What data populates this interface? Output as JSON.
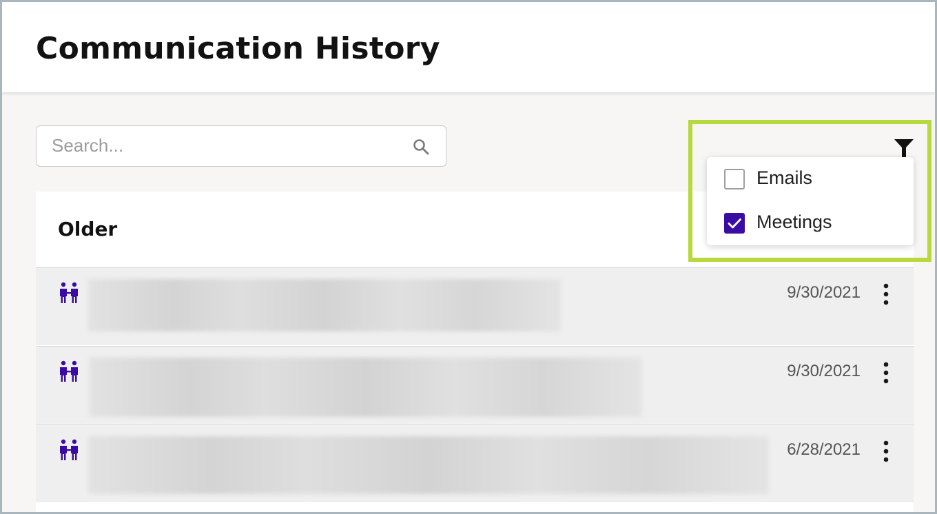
{
  "header": {
    "title": "Communication History"
  },
  "search": {
    "placeholder": "Search...",
    "value": "",
    "icon": "search-icon"
  },
  "filter": {
    "icon": "filter-icon",
    "options": [
      {
        "label": "Emails",
        "checked": false
      },
      {
        "label": "Meetings",
        "checked": true
      }
    ]
  },
  "list": {
    "group_title": "Older",
    "items": [
      {
        "type_icon": "meeting-icon",
        "date": "9/30/2021",
        "menu_icon": "more-vertical-icon"
      },
      {
        "type_icon": "meeting-icon",
        "date": "9/30/2021",
        "menu_icon": "more-vertical-icon"
      },
      {
        "type_icon": "meeting-icon",
        "date": "6/28/2021",
        "menu_icon": "more-vertical-icon"
      }
    ]
  },
  "colors": {
    "accent": "#3a0ca3",
    "highlight": "#b7d93d",
    "background": "#f7f6f5",
    "row_background": "#efefef"
  }
}
